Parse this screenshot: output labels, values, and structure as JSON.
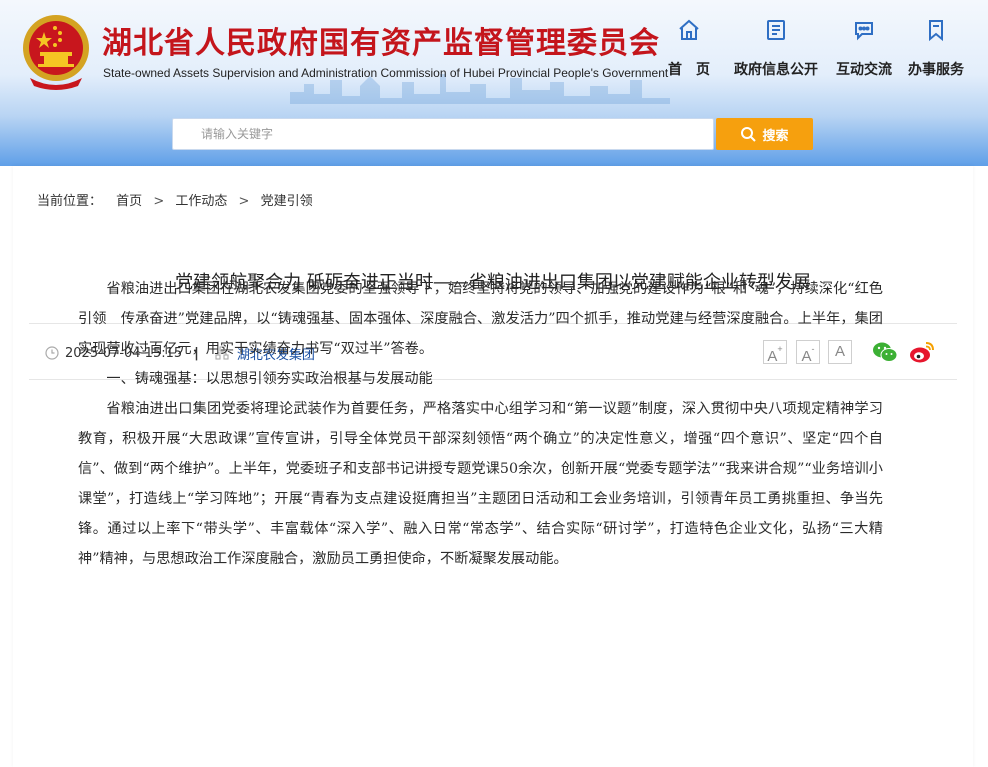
{
  "header": {
    "site_title": "湖北省人民政府国有资产监督管理委员会",
    "site_subtitle": "State-owned Assets Supervision and Administration Commission of Hubei Provincial People's Government",
    "brand_color": "#c4151c"
  },
  "nav": {
    "items": [
      {
        "label": "首　页",
        "icon": "home-icon"
      },
      {
        "label": "政府信息公开",
        "icon": "document-icon"
      },
      {
        "label": "互动交流",
        "icon": "chat-bubble-icon"
      },
      {
        "label": "办事服务",
        "icon": "bookmark-icon"
      }
    ],
    "icon_color": "#2f6fc4"
  },
  "search": {
    "placeholder": "请输入关键字",
    "button_label": "搜索",
    "button_color": "#f6a00e"
  },
  "breadcrumb": {
    "lead": "当前位置：",
    "items": [
      "首页",
      "工作动态",
      "党建引领"
    ],
    "separator": ">"
  },
  "article": {
    "title": "党建领航聚合力 砥砺奋进正当时——省粮油进出口集团以党建赋能企业转型发展",
    "date": "2025-07-04 15:15",
    "separator": "|",
    "source": "湖北农发集团",
    "font_controls": [
      "A+",
      "A-",
      "A"
    ],
    "share": [
      "wechat-icon",
      "weibo-icon"
    ],
    "paragraphs": [
      "省粮油进出口集团在湖北农发集团党委的坚强领导下，始终坚持将党的领导、加强党的建设作为“根”和“魂”，持续深化“红色引领　传承奋进”党建品牌，以“铸魂强基、固本强体、深度融合、激发活力”四个抓手，推动党建与经营深度融合。上半年，集团实现营收过百亿元，用实干实绩奋力书写“双过半”答卷。",
      "一、铸魂强基：以思想引领夯实政治根基与发展动能",
      "省粮油进出口集团党委将理论武装作为首要任务，严格落实中心组学习和“第一议题”制度，深入贯彻中央八项规定精神学习教育，积极开展“大思政课”宣传宣讲，引导全体党员干部深刻领悟“两个确立”的决定性意义，增强“四个意识”、坚定“四个自信”、做到“两个维护”。上半年，党委班子和支部书记讲授专题党课50余次，创新开展“党委专题学法”“我来讲合规”“业务培训小课堂”，打造线上“学习阵地”；开展“青春为支点建设挺膺担当”主题团日活动和工会业务培训，引领青年员工勇挑重担、争当先锋。通过以上率下“带头学”、丰富载体“深入学”、融入日常“常态学”、结合实际“研讨学”，打造特色企业文化，弘扬“三大精神”精神，与思想政治工作深度融合，激励员工勇担使命，不断凝聚发展动能。"
    ]
  }
}
